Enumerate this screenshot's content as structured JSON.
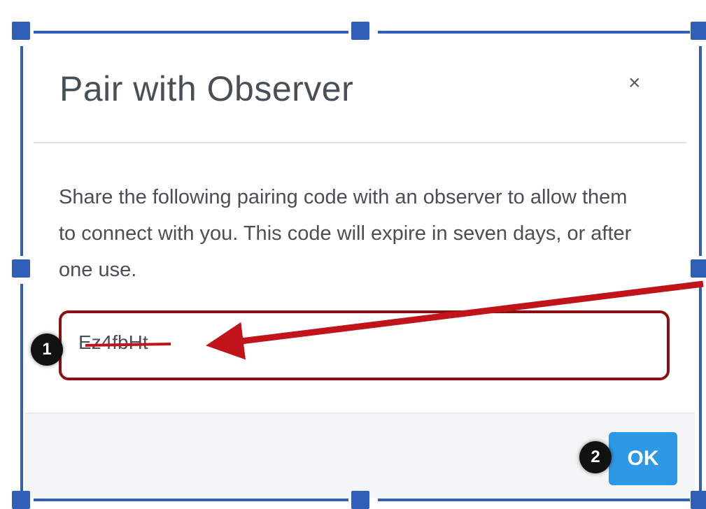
{
  "dialog": {
    "title": "Pair with Observer",
    "close_icon": "×",
    "description": "Share the following pairing code with an observer to allow them to connect with you. This code will expire in seven days, or after one use.",
    "pairing_code": "Ez4fbHt",
    "ok_label": "OK"
  },
  "annotations": {
    "badge_1": "1",
    "badge_2": "2"
  },
  "colors": {
    "frame": "#2f5fb8",
    "highlight": "#8b0f12",
    "arrow": "#c0141a",
    "ok_button": "#2d98e3"
  }
}
